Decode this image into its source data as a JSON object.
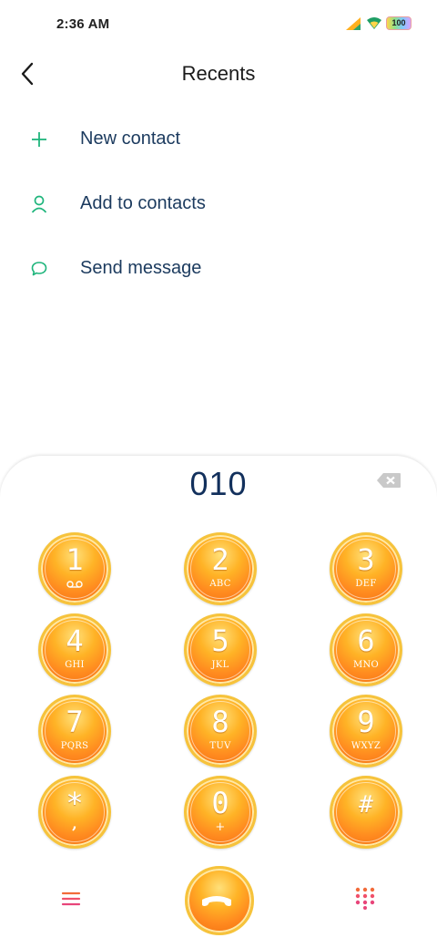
{
  "status_bar": {
    "time": "2:36 AM",
    "battery_level": "100",
    "icons": [
      "signal-icon",
      "wifi-icon",
      "battery-icon"
    ]
  },
  "header": {
    "title": "Recents",
    "back_icon": "back-arrow-icon"
  },
  "actions": [
    {
      "label": "New contact",
      "icon": "plus-icon"
    },
    {
      "label": "Add to contacts",
      "icon": "person-icon"
    },
    {
      "label": "Send message",
      "icon": "message-bubble-icon"
    }
  ],
  "dialer": {
    "number": "010",
    "backspace_icon": "backspace-icon",
    "keys": [
      {
        "digit": "1",
        "letters": ""
      },
      {
        "digit": "2",
        "letters": "ABC"
      },
      {
        "digit": "3",
        "letters": "DEF"
      },
      {
        "digit": "4",
        "letters": "GHI"
      },
      {
        "digit": "5",
        "letters": "JKL"
      },
      {
        "digit": "6",
        "letters": "MNO"
      },
      {
        "digit": "7",
        "letters": "PQRS"
      },
      {
        "digit": "8",
        "letters": "TUV"
      },
      {
        "digit": "9",
        "letters": "WXYZ"
      },
      {
        "digit": "*",
        "letters": ","
      },
      {
        "digit": "0",
        "letters": "+"
      },
      {
        "digit": "#",
        "letters": ""
      }
    ]
  },
  "bottom_bar": {
    "menu_icon": "menu-icon",
    "call_icon": "phone-icon",
    "keypad_icon": "dialpad-icon"
  },
  "colors": {
    "accent_green": "#1fb57c",
    "text_dark_blue": "#1b3a5e",
    "key_orange": "#ff9a1f",
    "key_ring": "#f6c33b"
  }
}
